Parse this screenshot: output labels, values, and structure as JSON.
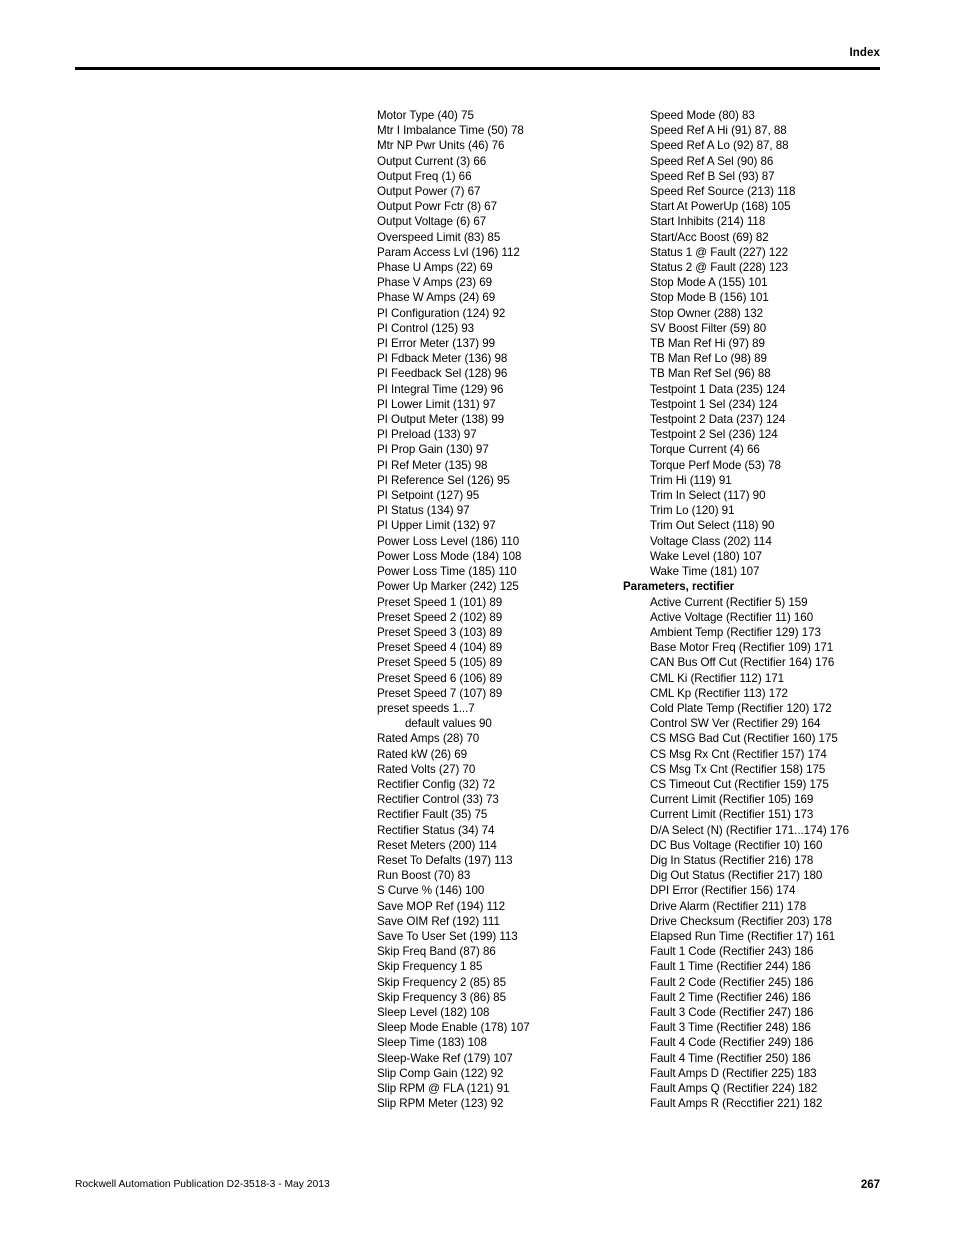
{
  "header": {
    "title": "Index"
  },
  "footer": {
    "publication": "Rockwell Automation Publication D2-3518-3 - May 2013",
    "page_number": "267"
  },
  "columns": {
    "left": [
      {
        "type": "entry",
        "text": "Motor Type (40) 75"
      },
      {
        "type": "entry",
        "text": "Mtr I Imbalance Time (50) 78"
      },
      {
        "type": "entry",
        "text": "Mtr NP Pwr Units (46) 76"
      },
      {
        "type": "entry",
        "text": "Output Current (3) 66"
      },
      {
        "type": "entry",
        "text": "Output Freq (1) 66"
      },
      {
        "type": "entry",
        "text": "Output Power (7) 67"
      },
      {
        "type": "entry",
        "text": "Output Powr Fctr (8) 67"
      },
      {
        "type": "entry",
        "text": "Output Voltage (6) 67"
      },
      {
        "type": "entry",
        "text": "Overspeed Limit (83) 85"
      },
      {
        "type": "entry",
        "text": "Param Access Lvl (196) 112"
      },
      {
        "type": "entry",
        "text": "Phase U Amps (22) 69"
      },
      {
        "type": "entry",
        "text": "Phase V Amps (23) 69"
      },
      {
        "type": "entry",
        "text": "Phase W Amps (24) 69"
      },
      {
        "type": "entry",
        "text": "PI Configuration (124) 92"
      },
      {
        "type": "entry",
        "text": "PI Control (125) 93"
      },
      {
        "type": "entry",
        "text": "PI Error Meter (137) 99"
      },
      {
        "type": "entry",
        "text": "PI Fdback Meter (136) 98"
      },
      {
        "type": "entry",
        "text": "PI Feedback Sel (128) 96"
      },
      {
        "type": "entry",
        "text": "PI Integral Time (129) 96"
      },
      {
        "type": "entry",
        "text": "PI Lower Limit (131) 97"
      },
      {
        "type": "entry",
        "text": "PI Output Meter (138) 99"
      },
      {
        "type": "entry",
        "text": "PI Preload (133) 97"
      },
      {
        "type": "entry",
        "text": "PI Prop Gain (130) 97"
      },
      {
        "type": "entry",
        "text": "PI Ref Meter (135) 98"
      },
      {
        "type": "entry",
        "text": "PI Reference Sel (126) 95"
      },
      {
        "type": "entry",
        "text": "PI Setpoint (127) 95"
      },
      {
        "type": "entry",
        "text": "PI Status (134) 97"
      },
      {
        "type": "entry",
        "text": "PI Upper Limit (132) 97"
      },
      {
        "type": "entry",
        "text": "Power Loss Level (186) 110"
      },
      {
        "type": "entry",
        "text": "Power Loss Mode (184) 108"
      },
      {
        "type": "entry",
        "text": "Power Loss Time (185) 110"
      },
      {
        "type": "entry",
        "text": "Power Up Marker (242) 125"
      },
      {
        "type": "entry",
        "text": "Preset Speed 1 (101) 89"
      },
      {
        "type": "entry",
        "text": "Preset Speed 2 (102) 89"
      },
      {
        "type": "entry",
        "text": "Preset Speed 3 (103) 89"
      },
      {
        "type": "entry",
        "text": "Preset Speed 4 (104) 89"
      },
      {
        "type": "entry",
        "text": "Preset Speed 5 (105) 89"
      },
      {
        "type": "entry",
        "text": "Preset Speed 6 (106) 89"
      },
      {
        "type": "entry",
        "text": "Preset Speed 7 (107) 89"
      },
      {
        "type": "entry",
        "text": "preset speeds 1...7"
      },
      {
        "type": "subentry",
        "text": "default values 90"
      },
      {
        "type": "entry",
        "text": "Rated Amps (28) 70"
      },
      {
        "type": "entry",
        "text": "Rated kW (26) 69"
      },
      {
        "type": "entry",
        "text": "Rated Volts (27) 70"
      },
      {
        "type": "entry",
        "text": "Rectifier Config (32) 72"
      },
      {
        "type": "entry",
        "text": "Rectifier Control (33) 73"
      },
      {
        "type": "entry",
        "text": "Rectifier Fault (35) 75"
      },
      {
        "type": "entry",
        "text": "Rectifier Status (34) 74"
      },
      {
        "type": "entry",
        "text": "Reset Meters (200) 114"
      },
      {
        "type": "entry",
        "text": "Reset To Defalts (197) 113"
      },
      {
        "type": "entry",
        "text": "Run Boost (70) 83"
      },
      {
        "type": "entry",
        "text": "S Curve % (146) 100"
      },
      {
        "type": "entry",
        "text": "Save MOP Ref (194) 112"
      },
      {
        "type": "entry",
        "text": "Save OIM Ref (192) 111"
      },
      {
        "type": "entry",
        "text": "Save To User Set (199) 113"
      },
      {
        "type": "entry",
        "text": "Skip Freq Band (87) 86"
      },
      {
        "type": "entry",
        "text": "Skip Frequency 1 85"
      },
      {
        "type": "entry",
        "text": "Skip Frequency 2 (85) 85"
      },
      {
        "type": "entry",
        "text": "Skip Frequency 3 (86) 85"
      },
      {
        "type": "entry",
        "text": "Sleep Level (182) 108"
      },
      {
        "type": "entry",
        "text": "Sleep Mode Enable (178) 107"
      },
      {
        "type": "entry",
        "text": "Sleep Time (183) 108"
      },
      {
        "type": "entry",
        "text": "Sleep-Wake Ref (179) 107"
      },
      {
        "type": "entry",
        "text": "Slip Comp Gain (122) 92"
      },
      {
        "type": "entry",
        "text": "Slip RPM @ FLA (121) 91"
      },
      {
        "type": "entry",
        "text": "Slip RPM Meter (123) 92"
      }
    ],
    "right": [
      {
        "type": "entry",
        "text": "Speed Mode (80) 83"
      },
      {
        "type": "entry",
        "text": "Speed Ref A Hi (91) 87, 88"
      },
      {
        "type": "entry",
        "text": "Speed Ref A Lo (92) 87, 88"
      },
      {
        "type": "entry",
        "text": "Speed Ref A Sel (90) 86"
      },
      {
        "type": "entry",
        "text": "Speed Ref B Sel (93) 87"
      },
      {
        "type": "entry",
        "text": "Speed Ref Source (213) 118"
      },
      {
        "type": "entry",
        "text": "Start At PowerUp (168) 105"
      },
      {
        "type": "entry",
        "text": "Start Inhibits (214) 118"
      },
      {
        "type": "entry",
        "text": "Start/Acc Boost (69) 82"
      },
      {
        "type": "entry",
        "text": "Status 1 @ Fault (227) 122"
      },
      {
        "type": "entry",
        "text": "Status 2 @ Fault (228) 123"
      },
      {
        "type": "entry",
        "text": "Stop Mode A (155) 101"
      },
      {
        "type": "entry",
        "text": "Stop Mode B (156) 101"
      },
      {
        "type": "entry",
        "text": "Stop Owner (288) 132"
      },
      {
        "type": "entry",
        "text": "SV Boost Filter (59) 80"
      },
      {
        "type": "entry",
        "text": "TB Man Ref Hi (97) 89"
      },
      {
        "type": "entry",
        "text": "TB Man Ref Lo (98) 89"
      },
      {
        "type": "entry",
        "text": "TB Man Ref Sel (96) 88"
      },
      {
        "type": "entry",
        "text": "Testpoint 1 Data (235) 124"
      },
      {
        "type": "entry",
        "text": "Testpoint 1 Sel (234) 124"
      },
      {
        "type": "entry",
        "text": "Testpoint 2 Data (237) 124"
      },
      {
        "type": "entry",
        "text": "Testpoint 2 Sel (236) 124"
      },
      {
        "type": "entry",
        "text": "Torque Current (4) 66"
      },
      {
        "type": "entry",
        "text": "Torque Perf Mode (53) 78"
      },
      {
        "type": "entry",
        "text": "Trim Hi (119) 91"
      },
      {
        "type": "entry",
        "text": "Trim In Select (117) 90"
      },
      {
        "type": "entry",
        "text": "Trim Lo (120) 91"
      },
      {
        "type": "entry",
        "text": "Trim Out Select (118) 90"
      },
      {
        "type": "entry",
        "text": "Voltage Class (202) 114"
      },
      {
        "type": "entry",
        "text": "Wake Level (180) 107"
      },
      {
        "type": "entry",
        "text": "Wake Time (181) 107"
      },
      {
        "type": "heading",
        "text": "Parameters, rectifier"
      },
      {
        "type": "entry",
        "text": "Active Current (Rectifier 5) 159"
      },
      {
        "type": "entry",
        "text": "Active Voltage (Rectifier 11) 160"
      },
      {
        "type": "entry",
        "text": "Ambient Temp (Rectifier 129) 173"
      },
      {
        "type": "entry",
        "text": "Base Motor Freq (Rectifier 109) 171"
      },
      {
        "type": "entry",
        "text": "CAN Bus Off Cut (Rectifier 164) 176"
      },
      {
        "type": "entry",
        "text": "CML Ki (Rectifier 112) 171"
      },
      {
        "type": "entry",
        "text": "CML Kp (Rectifier 113) 172"
      },
      {
        "type": "entry",
        "text": "Cold Plate Temp (Rectifier 120) 172"
      },
      {
        "type": "entry",
        "text": "Control SW Ver (Rectifier 29) 164"
      },
      {
        "type": "entry",
        "text": "CS MSG Bad Cut (Rectifier 160) 175"
      },
      {
        "type": "entry",
        "text": "CS Msg Rx Cnt (Rectifier 157) 174"
      },
      {
        "type": "entry",
        "text": "CS Msg Tx Cnt (Rectifier 158) 175"
      },
      {
        "type": "entry",
        "text": "CS Timeout Cut (Rectifier 159) 175"
      },
      {
        "type": "entry",
        "text": "Current Limit (Rectifier 105) 169"
      },
      {
        "type": "entry",
        "text": "Current Limit (Rectifier 151) 173"
      },
      {
        "type": "entry",
        "text": "D/A Select (N) (Rectifier 171...174) 176"
      },
      {
        "type": "entry",
        "text": "DC Bus Voltage (Rectifier 10) 160"
      },
      {
        "type": "entry",
        "text": "Dig In Status (Rectifier 216) 178"
      },
      {
        "type": "entry",
        "text": "Dig Out Status (Rectifier 217) 180"
      },
      {
        "type": "entry",
        "text": "DPI Error (Rectifier 156) 174"
      },
      {
        "type": "entry",
        "text": "Drive Alarm (Rectifier 211) 178"
      },
      {
        "type": "entry",
        "text": "Drive Checksum (Rectifier 203) 178"
      },
      {
        "type": "entry",
        "text": "Elapsed Run Time (Rectifier 17) 161"
      },
      {
        "type": "entry",
        "text": "Fault 1 Code (Rectifier 243) 186"
      },
      {
        "type": "entry",
        "text": "Fault 1 Time (Rectifier 244) 186"
      },
      {
        "type": "entry",
        "text": "Fault 2 Code (Rectifier 245) 186"
      },
      {
        "type": "entry",
        "text": "Fault 2 Time (Rectifier 246) 186"
      },
      {
        "type": "entry",
        "text": "Fault 3 Code (Rectifier 247) 186"
      },
      {
        "type": "entry",
        "text": "Fault 3 Time (Rectifier 248) 186"
      },
      {
        "type": "entry",
        "text": "Fault 4 Code (Rectifier 249) 186"
      },
      {
        "type": "entry",
        "text": "Fault 4 Time (Rectifier 250) 186"
      },
      {
        "type": "entry",
        "text": "Fault Amps D (Rectifier 225) 183"
      },
      {
        "type": "entry",
        "text": "Fault Amps Q (Rectifier 224) 182"
      },
      {
        "type": "entry",
        "text": "Fault Amps R (Recctifier 221) 182"
      }
    ]
  }
}
